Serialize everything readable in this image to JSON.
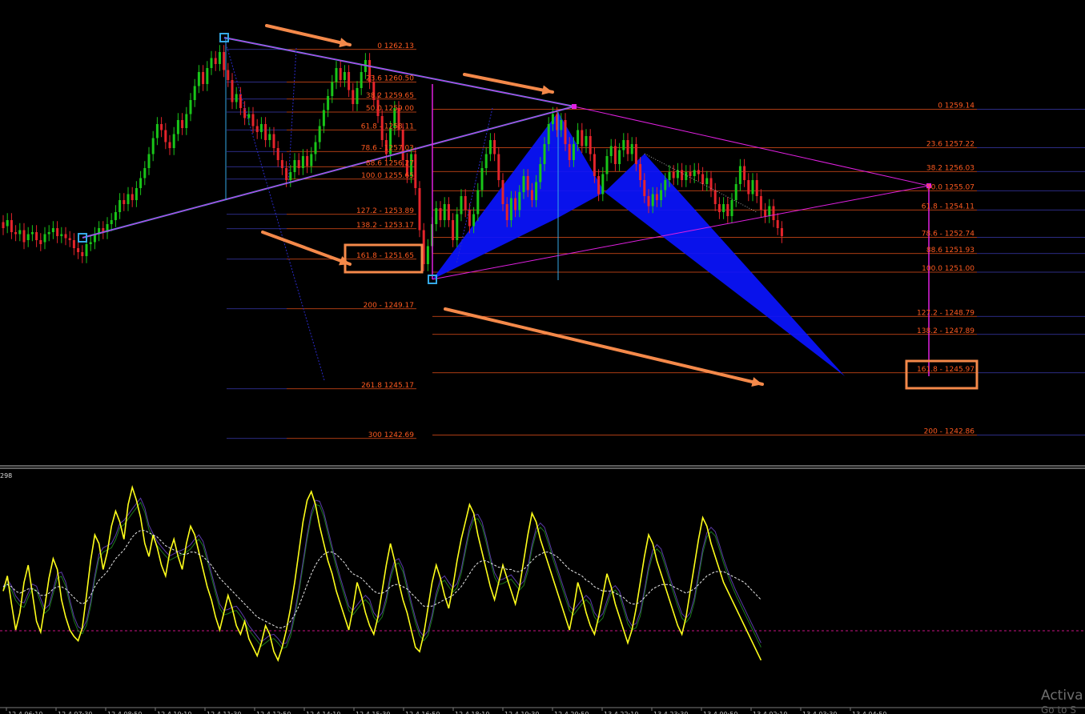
{
  "indicator": {
    "label": "298"
  },
  "fib_levels": [
    {
      "text": "0 1262.13",
      "side": "a"
    },
    {
      "text": "23.6 1260.50",
      "side": "a"
    },
    {
      "text": "38.2 1259.65",
      "side": "a"
    },
    {
      "text": "50.0 1259.00",
      "side": "a"
    },
    {
      "text": "61.8 - 1258.11",
      "side": "a"
    },
    {
      "text": "78.6 - 1257.03",
      "side": "a"
    },
    {
      "text": "88.6 1256.27",
      "side": "a"
    },
    {
      "text": "100.0 1255.65",
      "side": "a"
    },
    {
      "text": "127.2 - 1253.89",
      "side": "a"
    },
    {
      "text": "138.2 - 1253.17",
      "side": "a"
    },
    {
      "text": "161.8 - 1251.65",
      "side": "a"
    },
    {
      "text": "200 - 1249.17",
      "side": "a"
    },
    {
      "text": "261.8 1245.17",
      "side": "a"
    },
    {
      "text": "300 1242.69",
      "side": "a"
    },
    {
      "text": "0 1259.14",
      "side": "b"
    },
    {
      "text": "23.6 1257.22",
      "side": "b"
    },
    {
      "text": "38.2 1256.03",
      "side": "b"
    },
    {
      "text": "50.0 1255.07",
      "side": "b"
    },
    {
      "text": "61.8 - 1254.11",
      "side": "b"
    },
    {
      "text": "78.6 - 1252.74",
      "side": "b"
    },
    {
      "text": "88.6 1251.93",
      "side": "b"
    },
    {
      "text": "100.0 1251.00",
      "side": "b"
    },
    {
      "text": "127.2 - 1248.79",
      "side": "b"
    },
    {
      "text": "138.2 - 1247.89",
      "side": "b"
    },
    {
      "text": "161.8 - 1245.97",
      "side": "b"
    },
    {
      "text": "200 - 1242.86",
      "side": "b"
    }
  ],
  "time_axis": {
    "labels": [
      "12.4 06:10",
      "12.4 07:30",
      "12.4 08:50",
      "12.4 10:10",
      "12.4 11:30",
      "12.4 12:50",
      "12.4 14:10",
      "12.4 15:30",
      "12.4 16:50",
      "12.4 18:10",
      "12.4 19:30",
      "12.4 20:50",
      "13.4 22:10",
      "13.4 23:30",
      "13.4 00:50",
      "13.4 02:10",
      "13.4 03:30",
      "13.4 04:50"
    ]
  },
  "watermark": {
    "line1": "Activa",
    "line2": "Go to S"
  },
  "colors": {
    "background": "#000000",
    "bull": "#19c519",
    "bear": "#e5242b",
    "fib": "#ff5a1f",
    "grid": "#3b3bb0",
    "magenta": "#e020e0",
    "cyan": "#35a9e6",
    "pattern": "#0a14ff",
    "annotation": "#f4894a",
    "oscillator": "#ffff1a"
  },
  "chart_data": {
    "type": "candlestick",
    "price_range": [
      1241.8,
      1263.8
    ],
    "candles": [
      [
        1253.5,
        1253.2
      ],
      [
        1253.3,
        1253.6
      ],
      [
        1253.6,
        1253.0
      ],
      [
        1253.0,
        1252.9
      ],
      [
        1252.9,
        1253.1
      ],
      [
        1253.1,
        1252.5
      ],
      [
        1252.6,
        1252.9
      ],
      [
        1252.9,
        1253.0
      ],
      [
        1253.0,
        1252.6
      ],
      [
        1252.6,
        1252.4
      ],
      [
        1252.5,
        1252.9
      ],
      [
        1252.9,
        1253.0
      ],
      [
        1253.0,
        1253.2
      ],
      [
        1253.2,
        1252.8
      ],
      [
        1252.8,
        1252.9
      ],
      [
        1252.9,
        1252.7
      ],
      [
        1252.7,
        1252.6
      ],
      [
        1252.6,
        1252.2
      ],
      [
        1252.2,
        1252.0
      ],
      [
        1252.0,
        1251.8
      ],
      [
        1251.8,
        1252.4
      ],
      [
        1252.4,
        1252.5
      ],
      [
        1252.5,
        1252.9
      ],
      [
        1252.9,
        1253.2
      ],
      [
        1253.2,
        1253.0
      ],
      [
        1253.0,
        1253.4
      ],
      [
        1253.4,
        1253.6
      ],
      [
        1253.6,
        1254.0
      ],
      [
        1254.0,
        1254.6
      ],
      [
        1254.6,
        1254.4
      ],
      [
        1254.4,
        1254.9
      ],
      [
        1254.9,
        1254.6
      ],
      [
        1254.6,
        1255.2
      ],
      [
        1255.2,
        1255.7
      ],
      [
        1255.7,
        1256.2
      ],
      [
        1256.2,
        1256.9
      ],
      [
        1256.9,
        1257.7
      ],
      [
        1257.7,
        1258.4
      ],
      [
        1258.4,
        1258.1
      ],
      [
        1258.1,
        1257.5
      ],
      [
        1257.5,
        1257.2
      ],
      [
        1257.2,
        1257.9
      ],
      [
        1257.9,
        1258.6
      ],
      [
        1258.6,
        1258.2
      ],
      [
        1258.2,
        1258.9
      ],
      [
        1258.9,
        1259.6
      ],
      [
        1259.6,
        1260.3
      ],
      [
        1260.3,
        1261.0
      ],
      [
        1261.0,
        1260.4
      ],
      [
        1260.4,
        1261.2
      ],
      [
        1261.2,
        1261.7
      ],
      [
        1261.7,
        1261.4
      ],
      [
        1261.4,
        1262.0
      ],
      [
        1262.0,
        1261.1
      ],
      [
        1261.1,
        1260.6
      ],
      [
        1260.6,
        1259.5
      ],
      [
        1259.5,
        1259.9
      ],
      [
        1259.9,
        1259.2
      ],
      [
        1259.2,
        1258.7
      ],
      [
        1258.7,
        1258.9
      ],
      [
        1258.9,
        1258.3
      ],
      [
        1258.3,
        1258.0
      ],
      [
        1258.0,
        1258.4
      ],
      [
        1258.4,
        1257.6
      ],
      [
        1257.6,
        1257.9
      ],
      [
        1257.9,
        1257.2
      ],
      [
        1257.2,
        1256.6
      ],
      [
        1256.6,
        1256.2
      ],
      [
        1256.2,
        1255.6
      ],
      [
        1255.6,
        1256.0
      ],
      [
        1256.0,
        1256.6
      ],
      [
        1256.6,
        1256.2
      ],
      [
        1256.2,
        1256.8
      ],
      [
        1256.8,
        1256.3
      ],
      [
        1256.3,
        1256.9
      ],
      [
        1256.9,
        1257.5
      ],
      [
        1257.5,
        1258.3
      ],
      [
        1258.3,
        1259.1
      ],
      [
        1259.1,
        1259.8
      ],
      [
        1259.8,
        1260.5
      ],
      [
        1260.5,
        1261.2
      ],
      [
        1261.2,
        1260.6
      ],
      [
        1260.6,
        1261.0
      ],
      [
        1261.0,
        1260.1
      ],
      [
        1260.1,
        1259.4
      ],
      [
        1259.4,
        1260.2
      ],
      [
        1260.2,
        1261.0
      ],
      [
        1261.0,
        1261.6
      ],
      [
        1261.6,
        1260.5
      ],
      [
        1260.5,
        1259.6
      ],
      [
        1259.6,
        1258.8
      ],
      [
        1258.8,
        1257.6
      ],
      [
        1257.6,
        1256.9
      ],
      [
        1256.9,
        1258.2
      ],
      [
        1258.2,
        1259.2
      ],
      [
        1259.2,
        1258.1
      ],
      [
        1258.1,
        1256.6
      ],
      [
        1256.6,
        1255.8
      ],
      [
        1255.8,
        1256.9
      ],
      [
        1256.9,
        1255.2
      ],
      [
        1255.2,
        1253.1
      ],
      [
        1253.1,
        1251.4
      ],
      [
        1251.4,
        1252.3
      ],
      [
        1252.3,
        1253.4
      ],
      [
        1253.4,
        1254.2
      ],
      [
        1254.2,
        1253.6
      ],
      [
        1253.6,
        1254.4
      ],
      [
        1254.4,
        1253.6
      ],
      [
        1253.6,
        1252.6
      ],
      [
        1252.6,
        1253.9
      ],
      [
        1253.9,
        1254.8
      ],
      [
        1254.8,
        1254.1
      ],
      [
        1254.1,
        1253.3
      ],
      [
        1253.3,
        1253.9
      ],
      [
        1253.9,
        1255.1
      ],
      [
        1255.1,
        1256.2
      ],
      [
        1256.2,
        1256.9
      ],
      [
        1256.9,
        1257.6
      ],
      [
        1257.6,
        1256.9
      ],
      [
        1256.9,
        1255.6
      ],
      [
        1255.6,
        1254.4
      ],
      [
        1254.4,
        1253.6
      ],
      [
        1253.6,
        1254.7
      ],
      [
        1254.7,
        1254.1
      ],
      [
        1254.1,
        1255.0
      ],
      [
        1255.0,
        1255.8
      ],
      [
        1255.8,
        1255.1
      ],
      [
        1255.1,
        1254.6
      ],
      [
        1254.6,
        1255.5
      ],
      [
        1255.5,
        1256.4
      ],
      [
        1256.4,
        1257.4
      ],
      [
        1257.4,
        1258.4
      ],
      [
        1258.4,
        1258.9
      ],
      [
        1258.9,
        1258.1
      ],
      [
        1258.1,
        1258.6
      ],
      [
        1258.6,
        1257.4
      ],
      [
        1257.4,
        1256.6
      ],
      [
        1256.6,
        1257.4
      ],
      [
        1257.4,
        1258.1
      ],
      [
        1258.1,
        1257.3
      ],
      [
        1257.3,
        1257.8
      ],
      [
        1257.8,
        1256.9
      ],
      [
        1256.9,
        1255.8
      ],
      [
        1255.8,
        1254.9
      ],
      [
        1254.9,
        1255.9
      ],
      [
        1255.9,
        1256.8
      ],
      [
        1256.8,
        1257.3
      ],
      [
        1257.3,
        1256.4
      ],
      [
        1256.4,
        1257.1
      ],
      [
        1257.1,
        1257.6
      ],
      [
        1257.6,
        1256.9
      ],
      [
        1256.9,
        1257.4
      ],
      [
        1257.4,
        1256.4
      ],
      [
        1256.4,
        1255.6
      ],
      [
        1255.6,
        1254.8
      ],
      [
        1254.8,
        1254.3
      ],
      [
        1254.3,
        1254.9
      ],
      [
        1254.9,
        1254.6
      ],
      [
        1254.6,
        1255.1
      ],
      [
        1255.1,
        1255.6
      ],
      [
        1255.6,
        1256.0
      ],
      [
        1256.0,
        1255.7
      ],
      [
        1255.7,
        1256.1
      ],
      [
        1256.1,
        1255.6
      ],
      [
        1255.6,
        1256.0
      ],
      [
        1256.0,
        1255.8
      ],
      [
        1255.8,
        1256.1
      ],
      [
        1256.1,
        1255.9
      ],
      [
        1255.9,
        1255.4
      ],
      [
        1255.4,
        1255.7
      ],
      [
        1255.7,
        1255.1
      ],
      [
        1255.1,
        1254.4
      ],
      [
        1254.4,
        1254.0
      ],
      [
        1254.0,
        1254.4
      ],
      [
        1254.4,
        1253.8
      ],
      [
        1253.8,
        1254.6
      ],
      [
        1254.6,
        1255.4
      ],
      [
        1255.4,
        1256.3
      ],
      [
        1256.3,
        1255.6
      ],
      [
        1255.6,
        1254.9
      ],
      [
        1254.9,
        1255.6
      ],
      [
        1255.6,
        1254.8
      ],
      [
        1254.8,
        1254.1
      ],
      [
        1254.1,
        1253.8
      ],
      [
        1253.8,
        1254.3
      ],
      [
        1254.3,
        1253.6
      ],
      [
        1253.6,
        1253.2
      ],
      [
        1253.2,
        1252.8
      ]
    ],
    "oscillator": [
      48,
      55,
      42,
      30,
      38,
      52,
      60,
      47,
      34,
      29,
      41,
      54,
      63,
      58,
      44,
      36,
      30,
      27,
      25,
      31,
      46,
      62,
      74,
      70,
      58,
      66,
      78,
      85,
      80,
      72,
      88,
      96,
      90,
      82,
      70,
      64,
      74,
      68,
      60,
      55,
      66,
      72,
      64,
      58,
      70,
      78,
      74,
      66,
      58,
      50,
      44,
      36,
      30,
      38,
      46,
      40,
      32,
      28,
      34,
      26,
      22,
      18,
      24,
      32,
      28,
      20,
      16,
      22,
      30,
      40,
      52,
      66,
      80,
      90,
      94,
      88,
      78,
      70,
      62,
      56,
      48,
      42,
      36,
      30,
      40,
      52,
      46,
      38,
      32,
      28,
      36,
      48,
      60,
      70,
      62,
      52,
      44,
      38,
      30,
      22,
      20,
      28,
      40,
      52,
      60,
      54,
      46,
      40,
      50,
      62,
      72,
      80,
      88,
      84,
      74,
      66,
      58,
      50,
      44,
      52,
      60,
      54,
      48,
      42,
      50,
      62,
      74,
      84,
      80,
      72,
      66,
      60,
      54,
      48,
      42,
      36,
      30,
      40,
      52,
      46,
      38,
      32,
      28,
      36,
      46,
      56,
      50,
      42,
      36,
      30,
      24,
      30,
      40,
      52,
      64,
      74,
      70,
      62,
      56,
      50,
      44,
      38,
      32,
      28,
      36,
      48,
      60,
      72,
      82,
      78,
      70,
      64,
      58,
      52,
      48,
      44,
      40,
      36,
      32,
      28,
      24,
      20,
      16
    ],
    "signal_ma": [
      50,
      51,
      50,
      48,
      47,
      48,
      49,
      49,
      48,
      46,
      46,
      47,
      49,
      50,
      50,
      49,
      47,
      45,
      43,
      42,
      43,
      46,
      50,
      53,
      55,
      57,
      60,
      63,
      65,
      67,
      70,
      73,
      75,
      76,
      76,
      75,
      74,
      73,
      71,
      69,
      68,
      67,
      66,
      65,
      65,
      66,
      66,
      65,
      64,
      62,
      60,
      57,
      54,
      52,
      50,
      48,
      46,
      44,
      42,
      40,
      38,
      36,
      35,
      34,
      33,
      32,
      31,
      31,
      32,
      34,
      37,
      41,
      46,
      51,
      56,
      60,
      63,
      65,
      66,
      66,
      65,
      63,
      61,
      58,
      56,
      55,
      54,
      52,
      50,
      48,
      47,
      47,
      48,
      50,
      51,
      51,
      50,
      49,
      47,
      45,
      43,
      41,
      41,
      41,
      42,
      43,
      44,
      45,
      46,
      48,
      50,
      53,
      56,
      59,
      61,
      62,
      62,
      61,
      60,
      59,
      59,
      58,
      58,
      57,
      57,
      58,
      60,
      62,
      64,
      65,
      66,
      66,
      65,
      64,
      62,
      60,
      58,
      57,
      56,
      55,
      53,
      52,
      50,
      49,
      48,
      48,
      48,
      47,
      46,
      45,
      43,
      42,
      42,
      43,
      45,
      47,
      49,
      50,
      51,
      51,
      51,
      50,
      49,
      48,
      47,
      48,
      49,
      51,
      53,
      55,
      56,
      57,
      57,
      57,
      56,
      55,
      54,
      53,
      52,
      50,
      48,
      46,
      44
    ]
  }
}
